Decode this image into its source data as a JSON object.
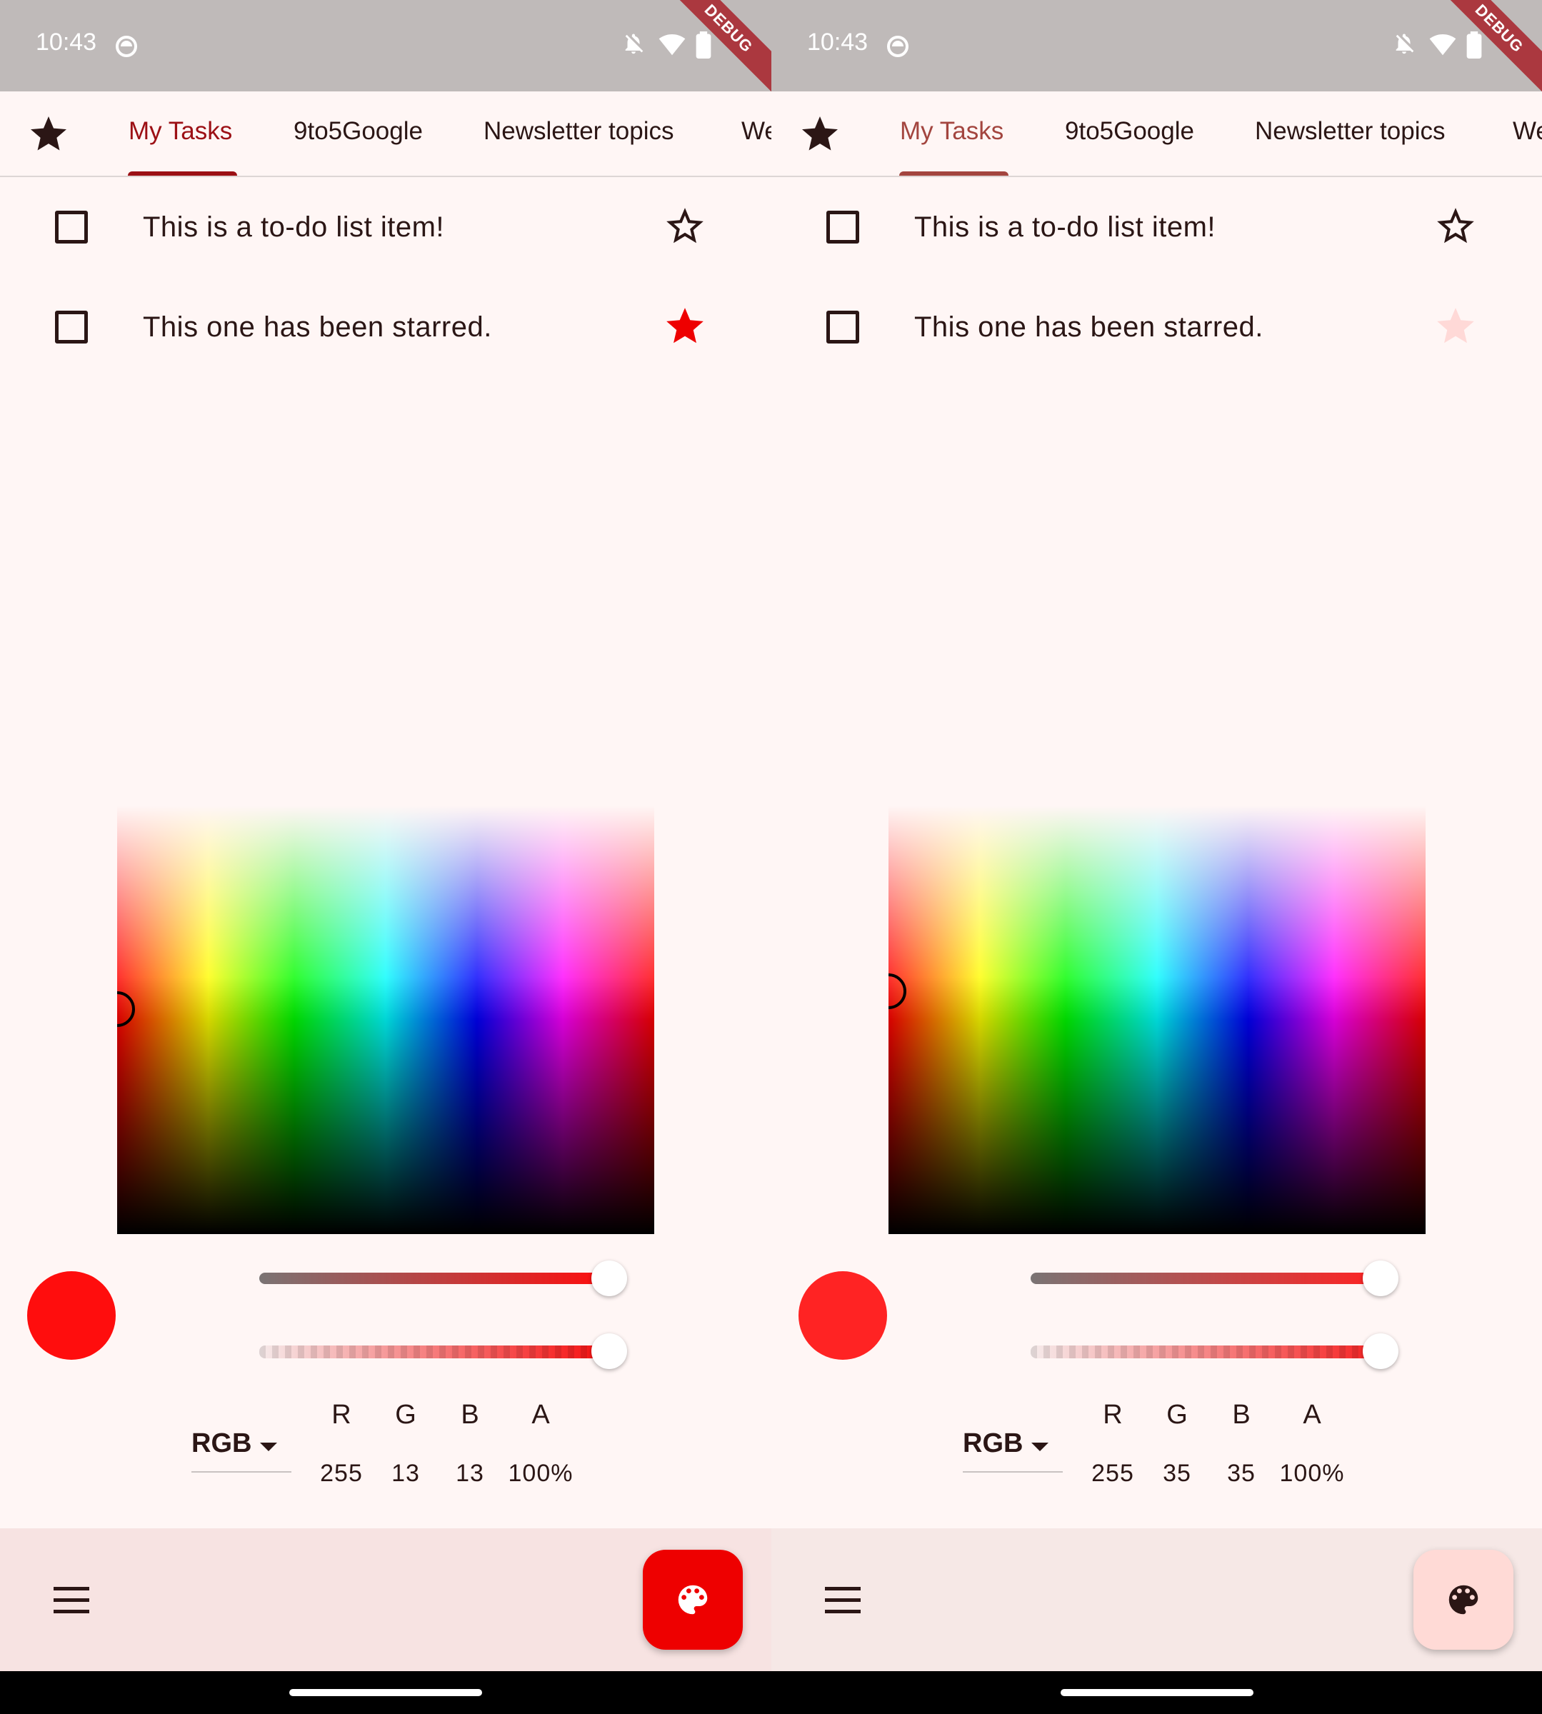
{
  "screens": [
    {
      "status": {
        "time": "10:43"
      },
      "debug_label": "DEBUG",
      "tabs": [
        {
          "label": "My Tasks",
          "active": true
        },
        {
          "label": "9to5Google",
          "active": false
        },
        {
          "label": "Newsletter topics",
          "active": false
        },
        {
          "label": "We",
          "active": false
        }
      ],
      "tasks": [
        {
          "text": "This is a to-do list item!",
          "starred": false
        },
        {
          "text": "This one has been starred.",
          "starred": true
        }
      ],
      "picker": {
        "selected_color": "#ff0d0d",
        "mode": "RGB",
        "channels": [
          {
            "label": "R",
            "value": "255"
          },
          {
            "label": "G",
            "value": "13"
          },
          {
            "label": "B",
            "value": "13"
          },
          {
            "label": "A",
            "value": "100%"
          }
        ],
        "hue_slider_level": 1.0,
        "alpha_slider_level": 1.0
      },
      "fab": {
        "icon": "palette-icon",
        "background": "#ee0000",
        "icon_color": "#ffffff"
      },
      "colors": {
        "accent": "#9c1015",
        "star_active": "#ee0000"
      }
    },
    {
      "status": {
        "time": "10:43"
      },
      "debug_label": "DEBUG",
      "tabs": [
        {
          "label": "My Tasks",
          "active": true
        },
        {
          "label": "9to5Google",
          "active": false
        },
        {
          "label": "Newsletter topics",
          "active": false
        },
        {
          "label": "We",
          "active": false
        }
      ],
      "tasks": [
        {
          "text": "This is a to-do list item!",
          "starred": false
        },
        {
          "text": "This one has been starred.",
          "starred": true
        }
      ],
      "picker": {
        "selected_color": "#ff2323",
        "mode": "RGB",
        "channels": [
          {
            "label": "R",
            "value": "255"
          },
          {
            "label": "G",
            "value": "35"
          },
          {
            "label": "B",
            "value": "35"
          },
          {
            "label": "A",
            "value": "100%"
          }
        ],
        "hue_slider_level": 1.0,
        "alpha_slider_level": 1.0
      },
      "fab": {
        "icon": "palette-icon",
        "background": "#ffdad6",
        "icon_color": "#2b1615"
      },
      "colors": {
        "accent": "#a3453f",
        "star_active": "#ffd9d7"
      }
    }
  ]
}
